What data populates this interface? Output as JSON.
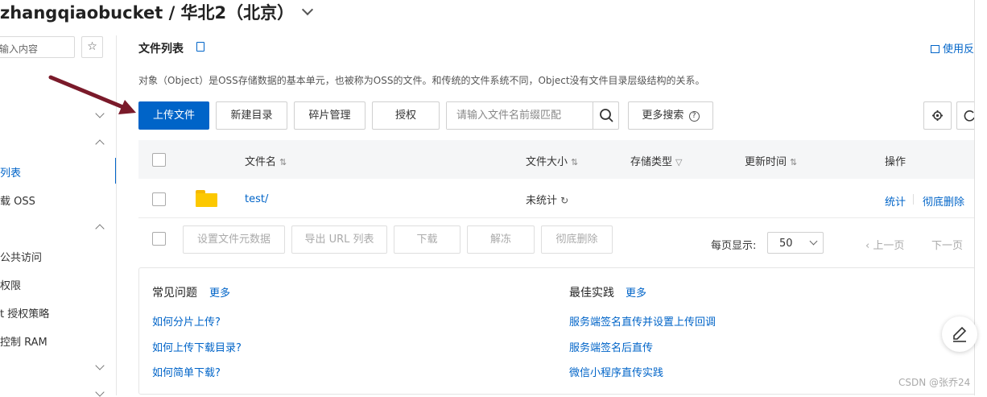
{
  "header": {
    "title": "zhangqiaobucket / 华北2（北京）"
  },
  "sidebar": {
    "search_placeholder": "输入内容",
    "items": [
      "列表",
      "载 OSS",
      "公共访问",
      "权限",
      "t 授权策略",
      "控制 RAM"
    ]
  },
  "main": {
    "section_title": "文件列表",
    "help_label": "使用反",
    "description": "对象（Object）是OSS存储数据的基本单元，也被称为OSS的文件。和传统的文件系统不同，Object没有文件目录层级结构的关系。",
    "toolbar": {
      "upload": "上传文件",
      "new_dir": "新建目录",
      "fragments": "碎片管理",
      "authorize": "授权",
      "search_placeholder": "请输入文件名前缀匹配",
      "more_search": "更多搜索"
    },
    "table": {
      "columns": [
        "文件名",
        "文件大小",
        "存储类型",
        "更新时间",
        "操作"
      ],
      "rows": [
        {
          "name": "test/",
          "size": "未统计",
          "actions": [
            "统计",
            "彻底删除"
          ]
        }
      ]
    },
    "batch": {
      "set_meta": "设置文件元数据",
      "export_url": "导出 URL 列表",
      "download": "下载",
      "unfreeze": "解冻",
      "delete": "彻底删除"
    },
    "pagination": {
      "per_page_label": "每页显示:",
      "per_page_value": "50",
      "prev": "上一页",
      "next": "下一页"
    },
    "faq": {
      "title": "常见问题",
      "more": "更多",
      "links": [
        "如何分片上传?",
        "如何上传下载目录?",
        "如何简单下载?"
      ]
    },
    "best_practice": {
      "title": "最佳实践",
      "more": "更多",
      "links": [
        "服务端签名直传并设置上传回调",
        "服务端签名后直传",
        "微信小程序直传实践"
      ]
    }
  },
  "watermark": "CSDN @张乔24",
  "colors": {
    "primary": "#0064c8",
    "arrow": "#7a1a2a",
    "folder": "#fcc800"
  }
}
